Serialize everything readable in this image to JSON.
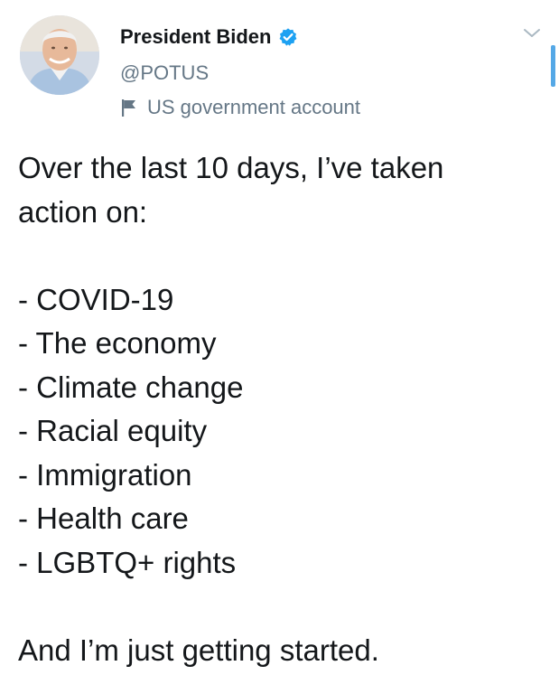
{
  "tweet": {
    "author": {
      "display_name": "President Biden",
      "handle": "@POTUS",
      "account_label": "US government account",
      "verified": true,
      "avatar": "profile-photo"
    },
    "text": {
      "intro_line_1": "Over the last 10 days, I’ve taken",
      "intro_line_2": "action on:",
      "items": [
        "- COVID-19",
        "- The economy",
        "- Climate change",
        "- Racial equity",
        "- Immigration",
        "- Health care",
        "- LGBTQ+ rights"
      ],
      "closing": "And I’m just getting started."
    }
  },
  "icons": {
    "verified": "verified-badge-icon",
    "label": "flag-icon",
    "menu": "chevron-down-icon"
  },
  "colors": {
    "accent": "#1da1f2",
    "text_primary": "#14171a",
    "text_secondary": "#657786",
    "background": "#ffffff"
  }
}
